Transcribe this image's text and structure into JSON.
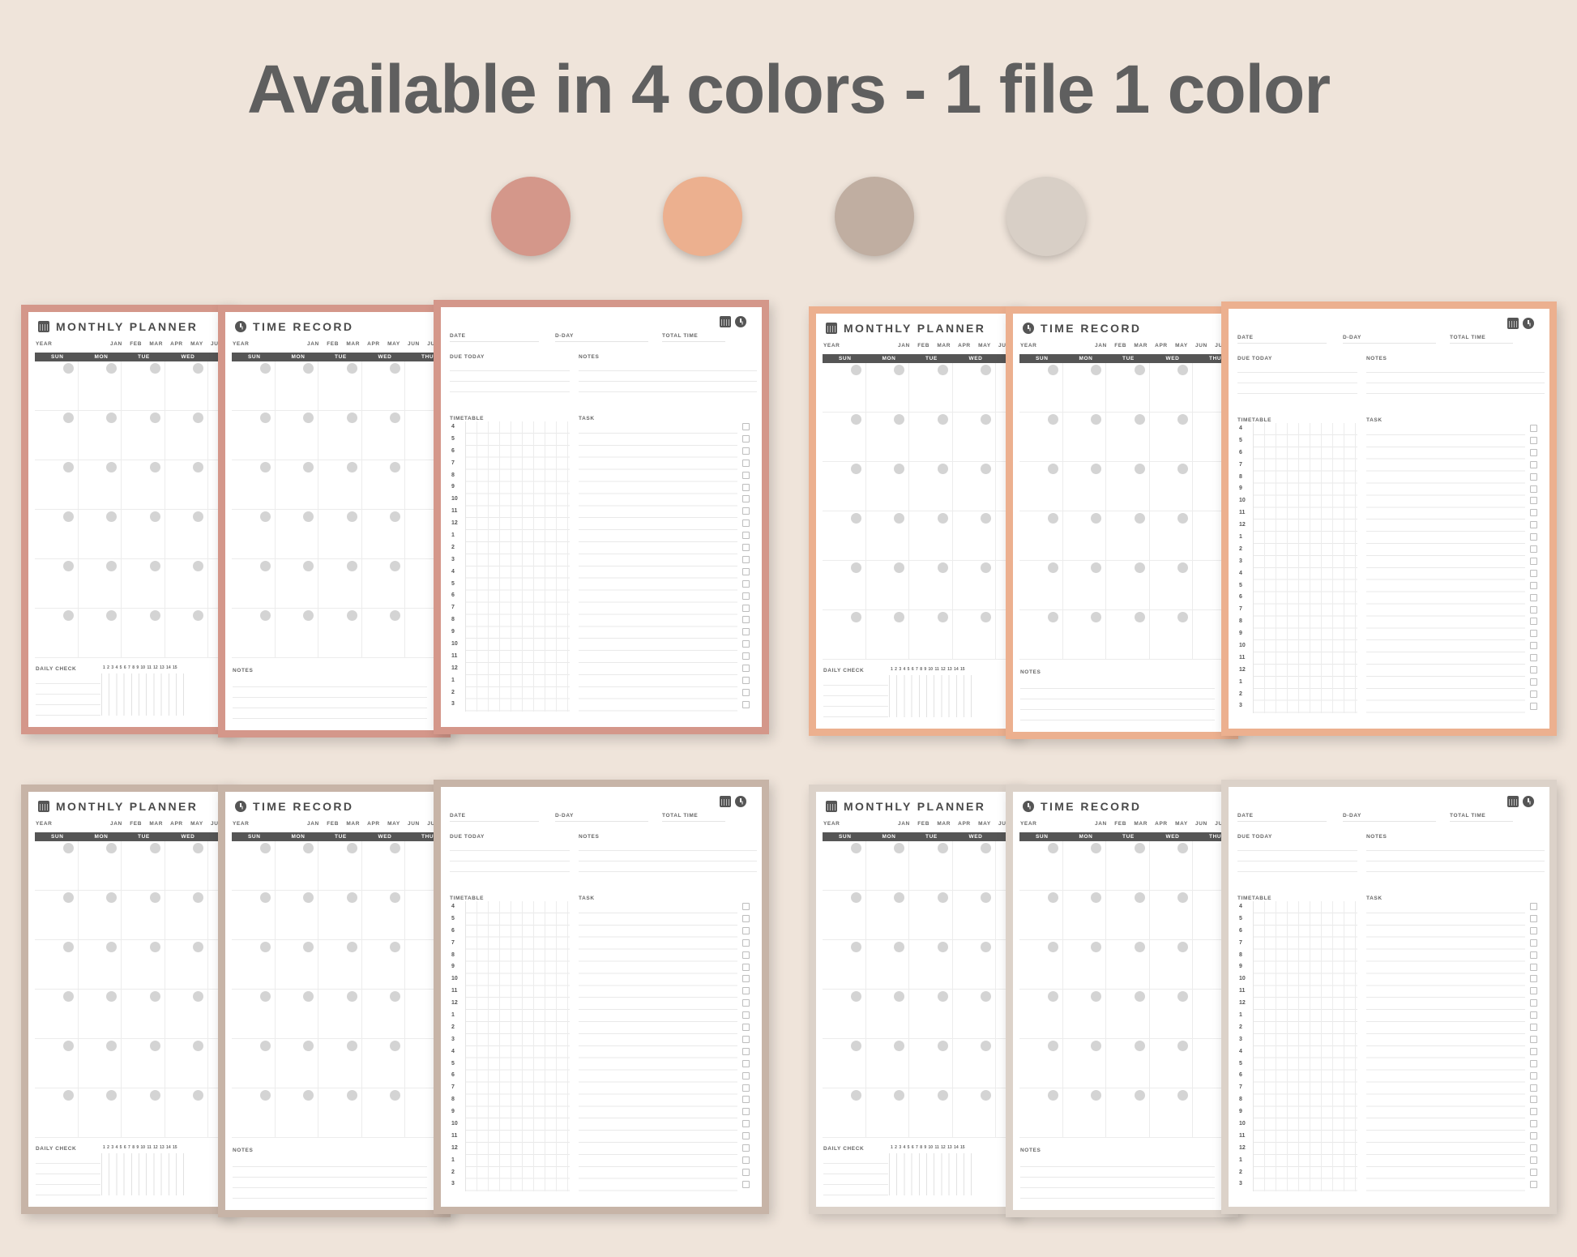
{
  "headline": "Available in 4 colors - 1 file 1 color",
  "swatches": [
    "#d4978a",
    "#ecb08f",
    "#c0aea1",
    "#d8cfc6"
  ],
  "monthly": {
    "title": "MONTHLY PLANNER",
    "icon": "calendar-icon",
    "year_label": "YEAR",
    "months": "JAN FEB MAR APR MAY JU",
    "days": [
      "SUN",
      "MON",
      "TUE",
      "WED"
    ],
    "daily_check": "DAILY CHECK",
    "check_numbers": "1 2 3 4 5 6 7 8 9 10 11 12 13 14 15"
  },
  "time": {
    "title": "TIME RECORD",
    "icon": "clock-icon",
    "year_label": "YEAR",
    "months": "JAN FEB MAR APR MAY JUN JU",
    "days": [
      "SUN",
      "MON",
      "TUE",
      "WED",
      "THU"
    ],
    "notes": "NOTES"
  },
  "daily": {
    "date": "DATE",
    "dday": "D-DAY",
    "total_time": "TOTAL TIME",
    "due_today": "DUE TODAY",
    "notes": "NOTES",
    "timetable": "TIMETABLE",
    "task": "TASK",
    "hours": [
      "4",
      "5",
      "6",
      "7",
      "8",
      "9",
      "10",
      "11",
      "12",
      "1",
      "2",
      "3",
      "4",
      "5",
      "6",
      "7",
      "8",
      "9",
      "10",
      "11",
      "12",
      "1",
      "2",
      "3"
    ]
  },
  "sets": [
    {
      "name": "terracotta",
      "color": "#d4978a"
    },
    {
      "name": "peach",
      "color": "#ecb08f"
    },
    {
      "name": "taupe",
      "color": "#c7b4a7"
    },
    {
      "name": "greige",
      "color": "#dcd2c9"
    }
  ]
}
